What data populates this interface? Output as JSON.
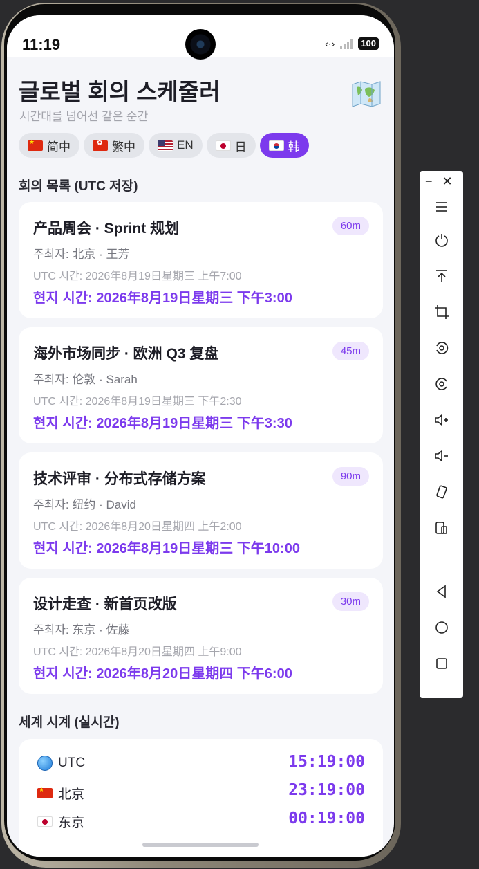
{
  "status_bar": {
    "time": "11:19",
    "battery": "100"
  },
  "header": {
    "title": "글로벌 회의 스케줄러",
    "subtitle": "시간대를 넘어선 같은 순간",
    "map_icon": "world-map-icon"
  },
  "languages": [
    {
      "label": "简中",
      "flag": "cn",
      "active": false
    },
    {
      "label": "繁中",
      "flag": "hk",
      "active": false
    },
    {
      "label": "EN",
      "flag": "us",
      "active": false
    },
    {
      "label": "日",
      "flag": "jp",
      "active": false
    },
    {
      "label": "韩",
      "flag": "kr",
      "active": true
    }
  ],
  "meetings_section": {
    "title": "회의 목록 (UTC 저장)"
  },
  "meetings": [
    {
      "title": "产品周会 · Sprint 规划",
      "duration": "60m",
      "host": "주최자: 北京 · 王芳",
      "utc": "UTC 시간: 2026年8月19日星期三 上午7:00",
      "local": "현지 시간: 2026年8月19日星期三 下午3:00"
    },
    {
      "title": "海外市场同步 · 欧洲 Q3 复盘",
      "duration": "45m",
      "host": "주최자: 伦敦 · Sarah",
      "utc": "UTC 시간: 2026年8月19日星期三 下午2:30",
      "local": "현지 시간: 2026年8月19日星期三 下午3:30"
    },
    {
      "title": "技术评审 · 分布式存储方案",
      "duration": "90m",
      "host": "주최자: 纽约 · David",
      "utc": "UTC 시간: 2026年8月20日星期四 上午2:00",
      "local": "현지 시간: 2026年8月19日星期三 下午10:00"
    },
    {
      "title": "设计走查 · 新首页改版",
      "duration": "30m",
      "host": "주최자: 东京 · 佐藤",
      "utc": "UTC 시간: 2026年8月20日星期四 上午9:00",
      "local": "현지 시간: 2026年8月20日星期四 下午6:00"
    }
  ],
  "clock_section": {
    "title": "세계 시계 (실시간)"
  },
  "clocks": [
    {
      "label": "UTC",
      "icon": "globe-icon",
      "time": "15:19:00"
    },
    {
      "label": "北京",
      "icon": "flag-cn",
      "time": "23:19:00"
    },
    {
      "label": "东京",
      "icon": "flag-jp",
      "time": "00:19:00"
    }
  ],
  "colors": {
    "accent": "#7c3aed",
    "background": "#f4f5f9",
    "card": "#ffffff"
  }
}
